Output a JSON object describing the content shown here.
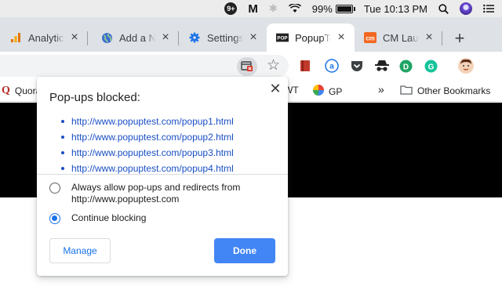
{
  "menubar": {
    "notification_badge": "9+",
    "battery_percent": "99%",
    "battery_level": 0.99,
    "clock": "Tue 10:13 PM"
  },
  "tabs": [
    {
      "title": "Analytics",
      "favicon": "analytics-icon"
    },
    {
      "title": "Add a New",
      "favicon": "globe-icon"
    },
    {
      "title": "Settings",
      "favicon": "settings-gear-icon"
    },
    {
      "title": "PopupTest",
      "favicon": "popuptest-icon",
      "active": true
    },
    {
      "title": "CM Launch",
      "favicon": "cm-icon"
    }
  ],
  "bookmarks": {
    "quora": "Quora",
    "wt": "WT",
    "gp": "GP",
    "overflow": "»",
    "other": "Other Bookmarks"
  },
  "popup": {
    "title": "Pop-ups blocked:",
    "links": [
      "http://www.popuptest.com/popup1.html",
      "http://www.popuptest.com/popup2.html",
      "http://www.popuptest.com/popup3.html",
      "http://www.popuptest.com/popup4.html"
    ],
    "allow_line1": "Always allow pop-ups and redirects from",
    "allow_line2": "http://www.popuptest.com",
    "continue_label": "Continue blocking",
    "manage_label": "Manage",
    "done_label": "Done",
    "selected_option": "continue"
  },
  "colors": {
    "link": "#1a4fc4",
    "accent": "#4285f4",
    "tabstrip": "#dee1e6"
  }
}
